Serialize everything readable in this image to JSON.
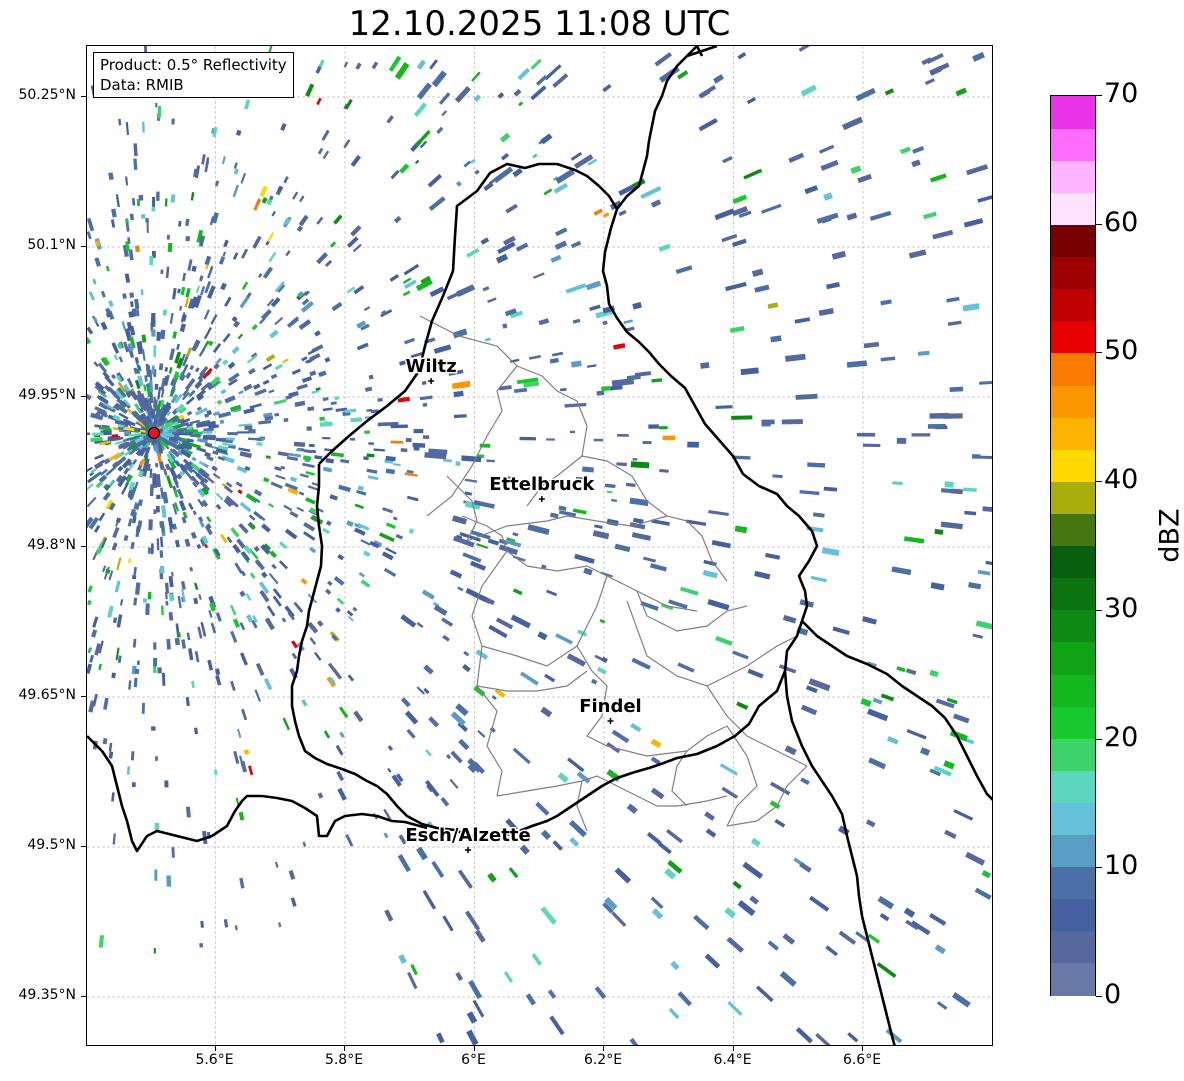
{
  "title": "12.10.2025 11:08 UTC",
  "info": {
    "product": "Product: 0.5° Reflectivity",
    "source": "Data: RMIB"
  },
  "axes": {
    "lon_range": [
      5.4,
      6.8
    ],
    "lat_range": [
      49.3,
      50.3
    ],
    "x_ticks": [
      {
        "value": 5.6,
        "label": "5.6°E"
      },
      {
        "value": 5.8,
        "label": "5.8°E"
      },
      {
        "value": 6.0,
        "label": "6°E"
      },
      {
        "value": 6.2,
        "label": "6.2°E"
      },
      {
        "value": 6.4,
        "label": "6.4°E"
      },
      {
        "value": 6.6,
        "label": "6.6°E"
      }
    ],
    "y_ticks": [
      {
        "value": 50.25,
        "label": "50.25°N"
      },
      {
        "value": 50.1,
        "label": "50.1°N"
      },
      {
        "value": 49.95,
        "label": "49.95°N"
      },
      {
        "value": 49.8,
        "label": "49.8°N"
      },
      {
        "value": 49.65,
        "label": "49.65°N"
      },
      {
        "value": 49.5,
        "label": "49.5°N"
      },
      {
        "value": 49.35,
        "label": "49.35°N"
      }
    ]
  },
  "radar_site": {
    "lon": 5.505,
    "lat": 49.914,
    "color": "#e8141e"
  },
  "cities": [
    {
      "name": "Wiltz",
      "lon": 5.933,
      "lat": 49.966
    },
    {
      "name": "Ettelbruck",
      "lon": 6.104,
      "lat": 49.848
    },
    {
      "name": "Findel",
      "lon": 6.21,
      "lat": 49.626
    },
    {
      "name": "Esch/Alzette",
      "lon": 5.99,
      "lat": 49.497
    }
  ],
  "colorbar": {
    "label": "dBZ",
    "min": 0,
    "max": 70,
    "ticks": [
      {
        "value": 0,
        "label": "0"
      },
      {
        "value": 10,
        "label": "10"
      },
      {
        "value": 20,
        "label": "20"
      },
      {
        "value": 30,
        "label": "30"
      },
      {
        "value": 40,
        "label": "40"
      },
      {
        "value": 50,
        "label": "50"
      },
      {
        "value": 60,
        "label": "60"
      },
      {
        "value": 70,
        "label": "70"
      }
    ],
    "colors": [
      "#6779a8",
      "#55699f",
      "#4460a0",
      "#4b6fa6",
      "#5b9cc5",
      "#65c1da",
      "#5dd6bf",
      "#3dd36b",
      "#16c92d",
      "#13b81f",
      "#11a316",
      "#0e8a12",
      "#0b7410",
      "#085e0c",
      "#467611",
      "#a9ae0b",
      "#fed800",
      "#fdb400",
      "#fd9700",
      "#fb7b00",
      "#e60000",
      "#bf0000",
      "#9e0000",
      "#790000",
      "#ffe2ff",
      "#ffb4ff",
      "#ff6cff",
      "#ea34ea"
    ]
  },
  "map_colors": {
    "country_border": "#000000",
    "canton_border": "#808080",
    "grid": "#bbbbbb"
  },
  "chart_data": {
    "type": "heatmap",
    "title": "12.10.2025 11:08 UTC",
    "xlabel": "",
    "ylabel": "",
    "xlim": [
      5.4,
      6.8
    ],
    "ylim": [
      49.3,
      50.3
    ],
    "colorbar_label": "dBZ",
    "zlim": [
      0,
      70
    ],
    "grid": true
  }
}
